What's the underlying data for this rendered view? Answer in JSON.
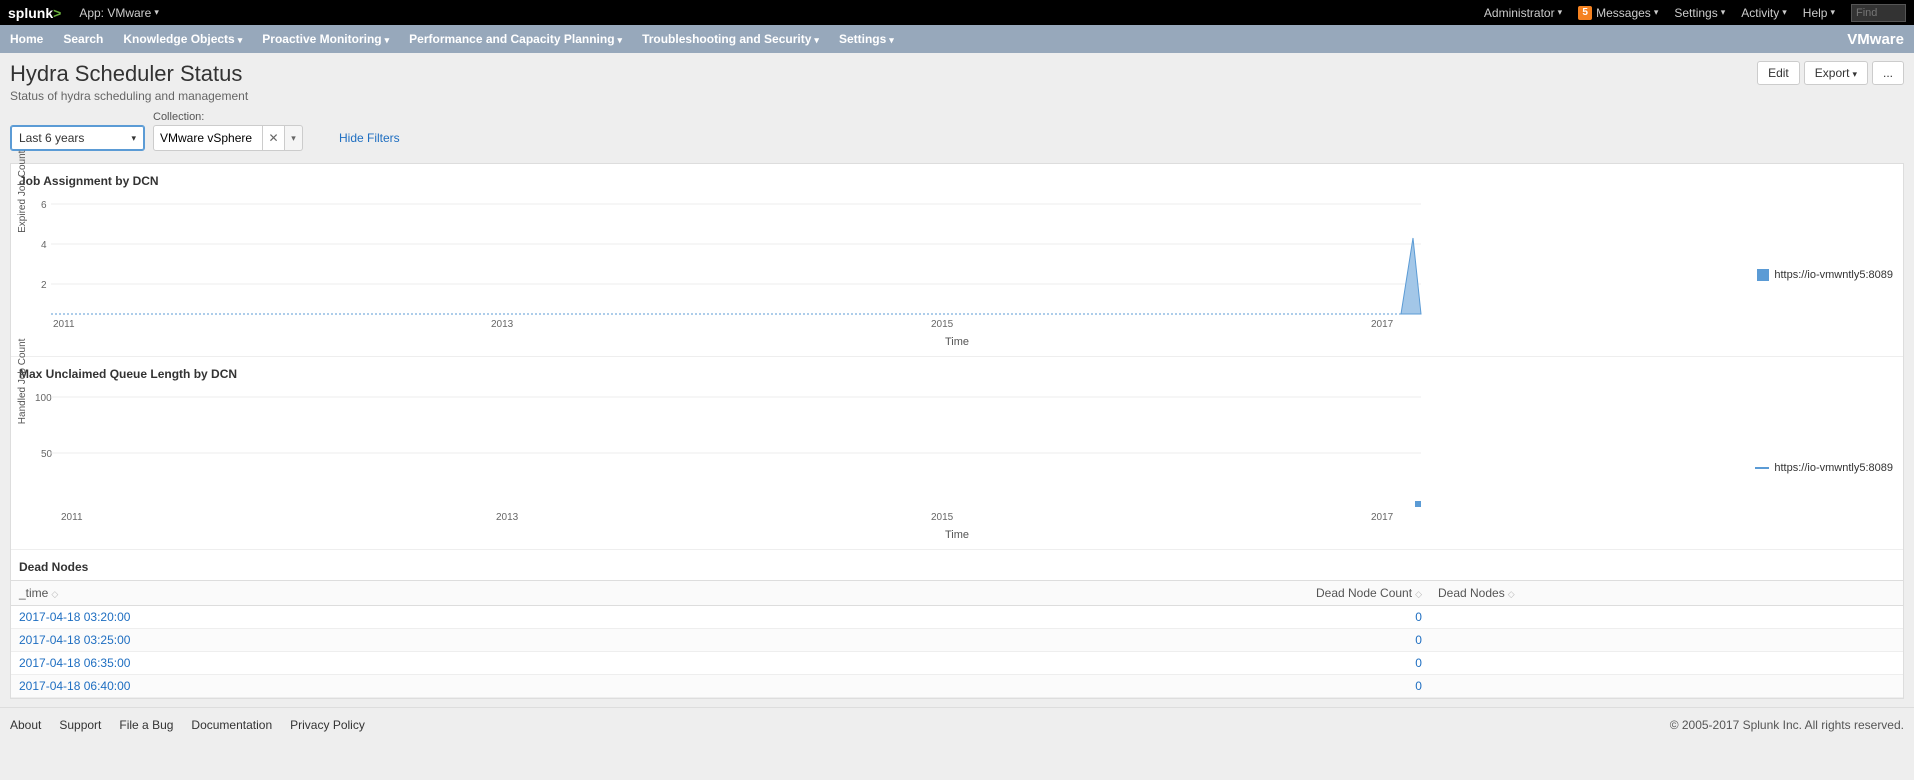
{
  "topbar": {
    "app_label": "App: VMware",
    "admin": "Administrator",
    "messages_count": "5",
    "messages": "Messages",
    "settings": "Settings",
    "activity": "Activity",
    "help": "Help",
    "find": "Find"
  },
  "nav": {
    "items": [
      "Home",
      "Search",
      "Knowledge Objects",
      "Proactive Monitoring",
      "Performance and Capacity Planning",
      "Troubleshooting and Security",
      "Settings"
    ],
    "brand": "VMware"
  },
  "page": {
    "title": "Hydra Scheduler Status",
    "subtitle": "Status of hydra scheduling and management",
    "edit": "Edit",
    "export": "Export",
    "more": "..."
  },
  "filters": {
    "time": "Last 6 years",
    "collection_label": "Collection:",
    "collection": "VMware vSphere",
    "hide": "Hide Filters"
  },
  "chart1": {
    "title": "Job Assignment by DCN",
    "ylabel": "Expired Job Count",
    "xlabel": "Time",
    "legend": "https://io-vmwntly5:8089"
  },
  "chart2": {
    "title": "Max Unclaimed Queue Length by DCN",
    "ylabel": "Handled Job Count",
    "xlabel": "Time",
    "legend": "https://io-vmwntly5:8089"
  },
  "dead": {
    "title": "Dead Nodes",
    "col_time": "_time",
    "col_count": "Dead Node Count",
    "col_nodes": "Dead Nodes",
    "rows": [
      {
        "time": "2017-04-18 03:20:00",
        "count": "0"
      },
      {
        "time": "2017-04-18 03:25:00",
        "count": "0"
      },
      {
        "time": "2017-04-18 06:35:00",
        "count": "0"
      },
      {
        "time": "2017-04-18 06:40:00",
        "count": "0"
      }
    ]
  },
  "footer": {
    "links": [
      "About",
      "Support",
      "File a Bug",
      "Documentation",
      "Privacy Policy"
    ],
    "copyright": "© 2005-2017 Splunk Inc. All rights reserved."
  },
  "chart_data": [
    {
      "type": "area",
      "title": "Job Assignment by DCN",
      "xlabel": "Time",
      "ylabel": "Expired Job Count",
      "x_ticks": [
        "2011",
        "2013",
        "2015",
        "2017"
      ],
      "y_ticks": [
        2,
        4,
        6
      ],
      "ylim": [
        0,
        6
      ],
      "series": [
        {
          "name": "https://io-vmwntly5:8089",
          "values": [
            {
              "x": "2011",
              "y": 0
            },
            {
              "x": "2017",
              "y": 0
            },
            {
              "x": "2017.3",
              "y": 4.3
            },
            {
              "x": "2017.35",
              "y": 0
            }
          ]
        }
      ]
    },
    {
      "type": "line",
      "title": "Max Unclaimed Queue Length by DCN",
      "xlabel": "Time",
      "ylabel": "Handled Job Count",
      "x_ticks": [
        "2011",
        "2013",
        "2015",
        "2017"
      ],
      "y_ticks": [
        50,
        100
      ],
      "ylim": [
        0,
        100
      ],
      "series": [
        {
          "name": "https://io-vmwntly5:8089",
          "values": [
            {
              "x": "2017.3",
              "y": 5
            }
          ]
        }
      ]
    }
  ]
}
